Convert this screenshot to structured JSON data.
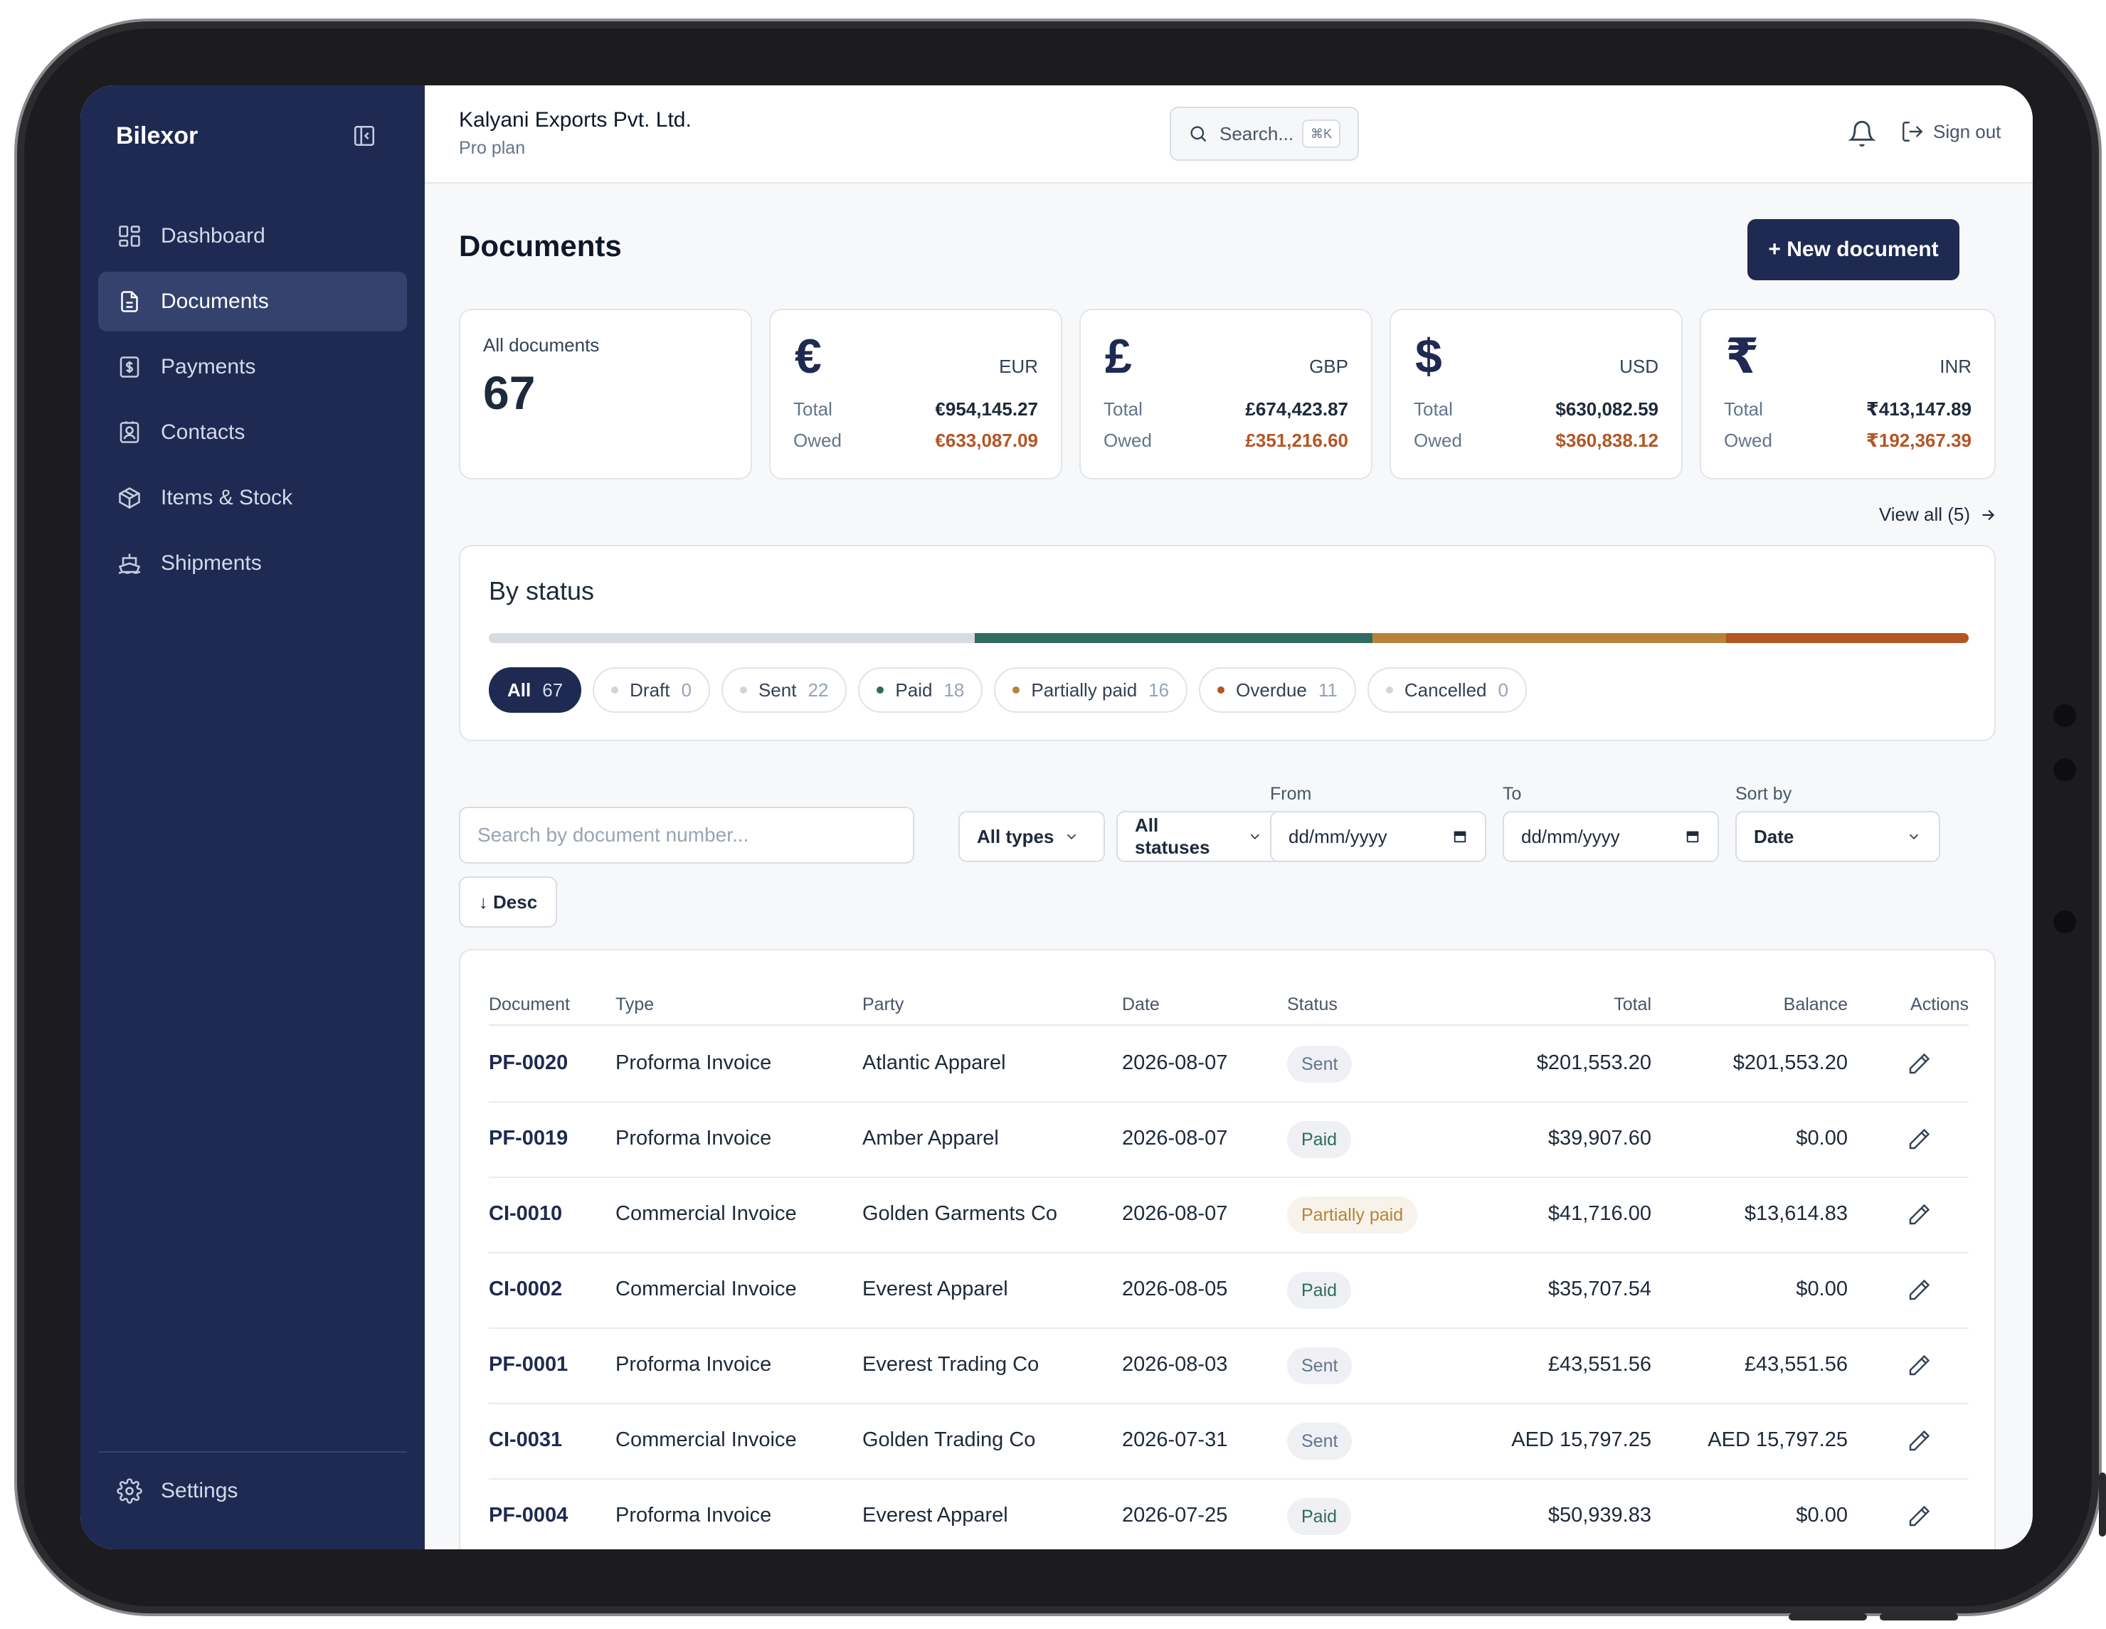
{
  "app": {
    "brand": "Bilexor"
  },
  "sidebar": {
    "items": [
      {
        "label": "Dashboard",
        "icon": "dashboard-icon"
      },
      {
        "label": "Documents",
        "icon": "document-icon"
      },
      {
        "label": "Payments",
        "icon": "payments-icon"
      },
      {
        "label": "Contacts",
        "icon": "contacts-icon"
      },
      {
        "label": "Items & Stock",
        "icon": "box-icon"
      },
      {
        "label": "Shipments",
        "icon": "ship-icon"
      }
    ],
    "settings": {
      "label": "Settings",
      "icon": "gear-icon"
    }
  },
  "header": {
    "org_name": "Kalyani Exports Pvt. Ltd.",
    "plan": "Pro plan",
    "search_label": "Search...",
    "search_shortcut": "⌘K",
    "sign_out": "Sign out"
  },
  "page": {
    "title": "Documents",
    "new_button": "+ New document"
  },
  "summary": {
    "all_label": "All documents",
    "all_count": "67",
    "currencies": [
      {
        "symbol": "€",
        "code": "EUR",
        "total_label": "Total",
        "total": "€954,145.27",
        "owed_label": "Owed",
        "owed": "€633,087.09"
      },
      {
        "symbol": "£",
        "code": "GBP",
        "total_label": "Total",
        "total": "£674,423.87",
        "owed_label": "Owed",
        "owed": "£351,216.60"
      },
      {
        "symbol": "$",
        "code": "USD",
        "total_label": "Total",
        "total": "$630,082.59",
        "owed_label": "Owed",
        "owed": "$360,838.12"
      },
      {
        "symbol": "₹",
        "code": "INR",
        "total_label": "Total",
        "total": "₹413,147.89",
        "owed_label": "Owed",
        "owed": "₹192,367.39"
      }
    ],
    "view_all": "View all (5)"
  },
  "status": {
    "title": "By status",
    "bar_colors": {
      "sent": "#d8dce2",
      "paid": "#2f6b5e",
      "partial": "#b8823b",
      "overdue": "#b45524"
    },
    "chips": [
      {
        "label": "All",
        "count": "67",
        "dot": ""
      },
      {
        "label": "Draft",
        "count": "0",
        "dot": "#d1d5db"
      },
      {
        "label": "Sent",
        "count": "22",
        "dot": "#d1d5db"
      },
      {
        "label": "Paid",
        "count": "18",
        "dot": "#2f6b5e"
      },
      {
        "label": "Partially paid",
        "count": "16",
        "dot": "#b8823b"
      },
      {
        "label": "Overdue",
        "count": "11",
        "dot": "#b45524"
      },
      {
        "label": "Cancelled",
        "count": "0",
        "dot": "#d1d5db"
      }
    ]
  },
  "filters": {
    "search_placeholder": "Search by document number...",
    "type": "All types",
    "status": "All statuses",
    "from_label": "From",
    "from_value": "dd/mm/yyyy",
    "to_label": "To",
    "to_value": "dd/mm/yyyy",
    "sort_label": "Sort by",
    "sort_value": "Date",
    "order": "↓ Desc"
  },
  "table": {
    "columns": [
      "Document",
      "Type",
      "Party",
      "Date",
      "Status",
      "Total",
      "Balance",
      "Actions"
    ],
    "rows": [
      {
        "doc": "PF-0020",
        "type": "Proforma Invoice",
        "party": "Atlantic Apparel",
        "date": "2026-08-07",
        "status": "Sent",
        "status_kind": "sent",
        "total": "$201,553.20",
        "balance": "$201,553.20"
      },
      {
        "doc": "PF-0019",
        "type": "Proforma Invoice",
        "party": "Amber Apparel",
        "date": "2026-08-07",
        "status": "Paid",
        "status_kind": "paid",
        "total": "$39,907.60",
        "balance": "$0.00"
      },
      {
        "doc": "CI-0010",
        "type": "Commercial Invoice",
        "party": "Golden Garments Co",
        "date": "2026-08-07",
        "status": "Partially paid",
        "status_kind": "partial",
        "total": "$41,716.00",
        "balance": "$13,614.83"
      },
      {
        "doc": "CI-0002",
        "type": "Commercial Invoice",
        "party": "Everest Apparel",
        "date": "2026-08-05",
        "status": "Paid",
        "status_kind": "paid",
        "total": "$35,707.54",
        "balance": "$0.00"
      },
      {
        "doc": "PF-0001",
        "type": "Proforma Invoice",
        "party": "Everest Trading Co",
        "date": "2026-08-03",
        "status": "Sent",
        "status_kind": "sent",
        "total": "£43,551.56",
        "balance": "£43,551.56"
      },
      {
        "doc": "CI-0031",
        "type": "Commercial Invoice",
        "party": "Golden Trading Co",
        "date": "2026-07-31",
        "status": "Sent",
        "status_kind": "sent",
        "total": "AED 15,797.25",
        "balance": "AED 15,797.25"
      },
      {
        "doc": "PF-0004",
        "type": "Proforma Invoice",
        "party": "Everest Apparel",
        "date": "2026-07-25",
        "status": "Paid",
        "status_kind": "paid",
        "total": "$50,939.83",
        "balance": "$0.00"
      }
    ]
  }
}
